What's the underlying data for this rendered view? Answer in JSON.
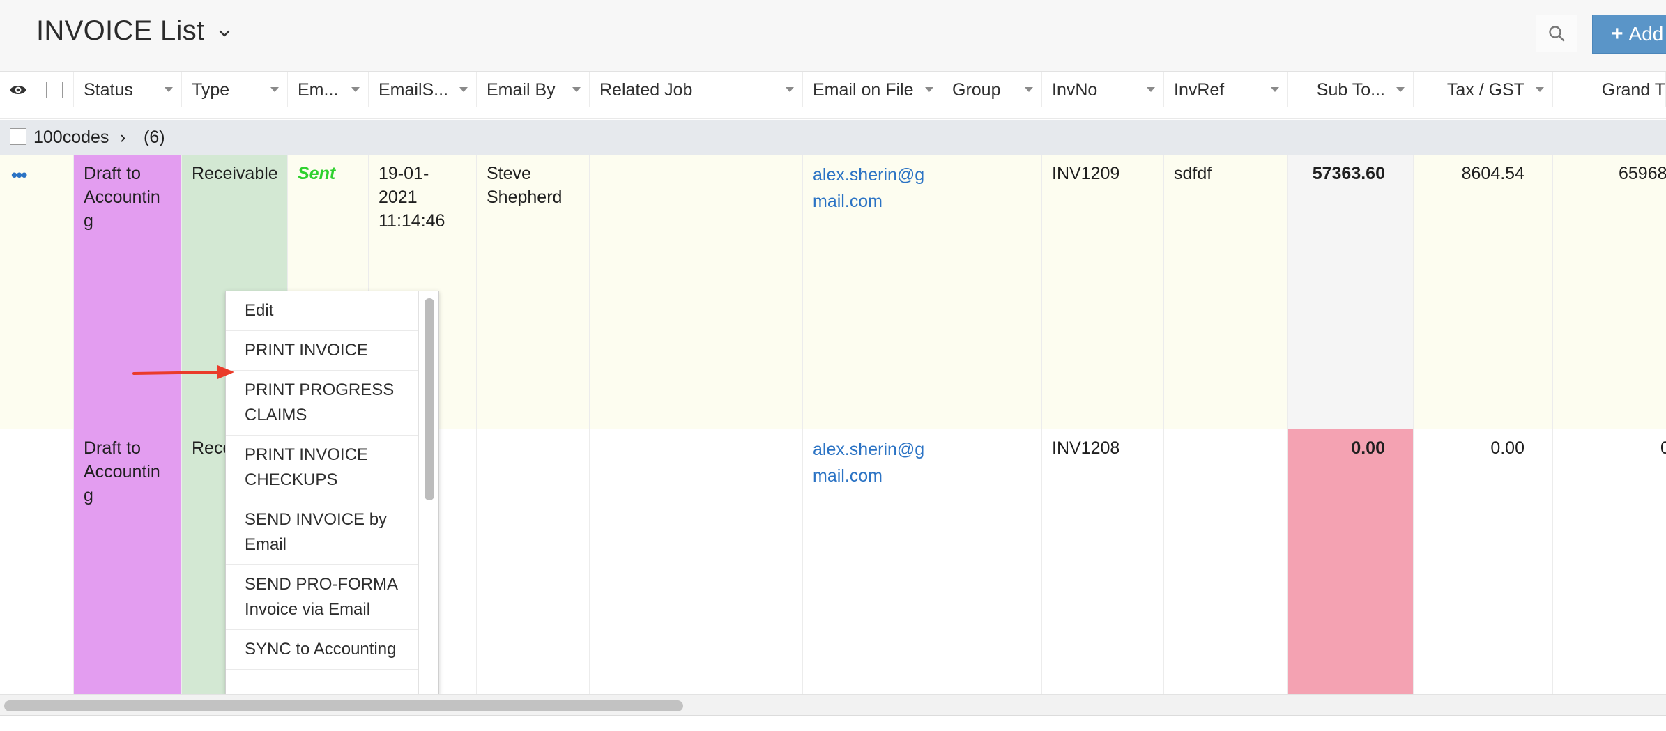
{
  "page": {
    "title": "INVOICE List",
    "add_label": "Add",
    "icons": {
      "title_dropdown": "chevron-down-icon",
      "search": "search-icon",
      "add": "plus-icon",
      "view": "eye-icon"
    }
  },
  "columns": [
    {
      "key": "status",
      "label": "Status"
    },
    {
      "key": "type",
      "label": "Type"
    },
    {
      "key": "em",
      "label": "Em..."
    },
    {
      "key": "email_sent",
      "label": "EmailS..."
    },
    {
      "key": "email_by",
      "label": "Email By"
    },
    {
      "key": "related_job",
      "label": "Related Job"
    },
    {
      "key": "email_on_file",
      "label": "Email on File"
    },
    {
      "key": "group",
      "label": "Group"
    },
    {
      "key": "invno",
      "label": "InvNo"
    },
    {
      "key": "invref",
      "label": "InvRef"
    },
    {
      "key": "subtotal",
      "label": "Sub To..."
    },
    {
      "key": "tax",
      "label": "Tax / GST"
    },
    {
      "key": "grand",
      "label": "Grand T"
    }
  ],
  "group": {
    "label": "100codes",
    "chevron": "›",
    "count": "(6)"
  },
  "rows": [
    {
      "actions": "•••",
      "status": "Draft to Accountin g",
      "type": "Receivable",
      "email_status": "Sent",
      "email_sent": "19-01- 2021 11:14:46",
      "email_by": "Steve Shepherd",
      "related_job": "",
      "email_on_file": "alex.sherin@g mail.com",
      "group": "",
      "invno": "INV1209",
      "invref": "sdfdf",
      "subtotal": "57363.60",
      "tax": "8604.54",
      "grand": "65968"
    },
    {
      "actions": "",
      "status": "Draft to Accountin g",
      "type": "Rece",
      "email_status": "",
      "email_sent": "",
      "email_by": "",
      "related_job": "",
      "email_on_file": "alex.sherin@g mail.com",
      "group": "",
      "invno": "INV1208",
      "invref": "",
      "subtotal": "0.00",
      "tax": "0.00",
      "grand": "0"
    }
  ],
  "context_menu": {
    "items": [
      "Edit",
      "PRINT INVOICE",
      "PRINT PROGRESS CLAIMS",
      "PRINT INVOICE CHECKUPS",
      "SEND INVOICE by Email",
      "SEND PRO-FORMA Invoice via Email",
      "SYNC to Accounting"
    ]
  },
  "colors": {
    "status_bg": "#e39df0",
    "type_bg": "#d3e8d3",
    "sent_text": "#2ed12e",
    "email_link": "#2b73c4",
    "subtotal_zero_bg": "#f4a2b2",
    "add_button": "#5a95c8",
    "annotation_arrow": "#ea3b2a"
  }
}
